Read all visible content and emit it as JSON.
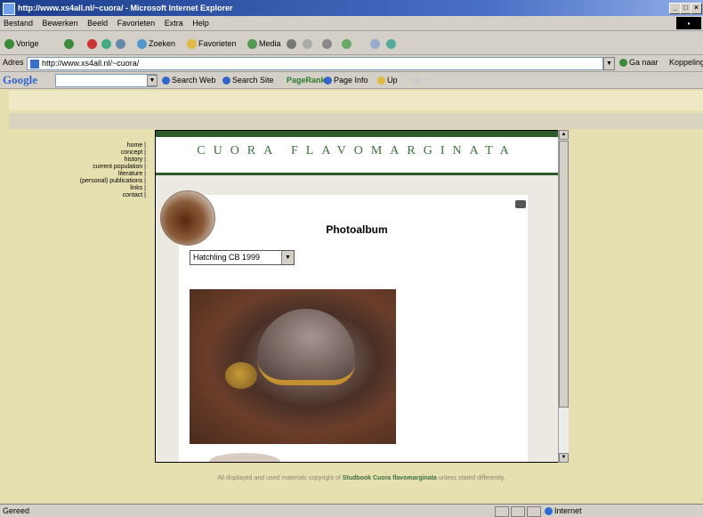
{
  "window": {
    "title": "http://www.xs4all.nl/~cuora/ - Microsoft Internet Explorer",
    "min": "_",
    "max": "□",
    "close": "×"
  },
  "menu": [
    "Bestand",
    "Bewerken",
    "Beeld",
    "Favorieten",
    "Extra",
    "Help"
  ],
  "toolbar": {
    "back": "Vorige",
    "search": "Zoeken",
    "favorites": "Favorieten",
    "media": "Media"
  },
  "address": {
    "label": "Adres",
    "url": "http://www.xs4all.nl/~cuora/",
    "go": "Ga naar",
    "links": "Koppelingen"
  },
  "google": {
    "logo": "Google",
    "search_web": "Search Web",
    "search_site": "Search Site",
    "pagerank": "PageRank",
    "page_info": "Page Info",
    "up": "Up"
  },
  "site": {
    "banner": "CUORA FLAVOMARGINATA",
    "nav": [
      "home |",
      "concept |",
      "history |",
      "current population |",
      "literature |",
      "(personal) publications |",
      "links |",
      "contact |"
    ],
    "heading": "Photoalbum",
    "album_selected": "Hatchling CB 1999",
    "footer_text": "All displayed and used materials copyright of",
    "footer_link": "Studbook Cuora flavomarginata",
    "footer_suffix": "unless stated differently."
  },
  "status": {
    "text": "Gereed",
    "zone": "Internet"
  }
}
